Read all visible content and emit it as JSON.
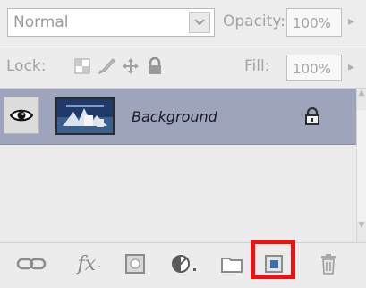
{
  "blend_mode": {
    "value": "Normal"
  },
  "opacity": {
    "label": "Opacity:",
    "value": "100%"
  },
  "lock": {
    "label": "Lock:"
  },
  "fill": {
    "label": "Fill:",
    "value": "100%"
  },
  "layers": [
    {
      "name": "Background",
      "visible": true,
      "locked": true,
      "selected": true
    }
  ],
  "toolbar": {
    "buttons": [
      "link-layers-icon",
      "layer-style-fx-icon",
      "layer-mask-icon",
      "adjustment-layer-icon",
      "new-group-icon",
      "new-layer-icon",
      "delete-layer-icon"
    ],
    "fx_label": "fx"
  },
  "colors": {
    "selected_row": "#9fa4bd",
    "highlight": "#ee1111",
    "panel_bg": "#ececec"
  }
}
